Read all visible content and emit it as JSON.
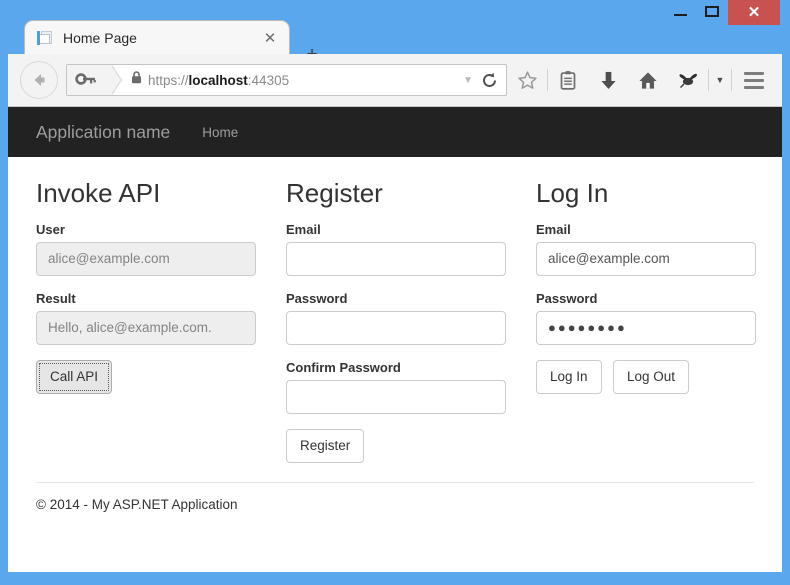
{
  "window": {
    "controls": {
      "minimize_label": "Minimize",
      "maximize_label": "Maximize",
      "close_label": "✕"
    },
    "frame_color": "#5aa7ee",
    "close_color": "#c7524f"
  },
  "browser": {
    "tab": {
      "title": "Home Page",
      "close_label": "✕",
      "favicon_name": "page-favicon"
    },
    "newtab_label": "+",
    "toolbar": {
      "back_label": "Back",
      "url_scheme": "https://",
      "url_host": "localhost",
      "url_port": ":44305",
      "url_full": "https://localhost:44305",
      "url_caret": "▼",
      "reload_label": "Reload",
      "buttons": [
        {
          "name": "bookmark-star-icon",
          "label": "Bookmark"
        },
        {
          "name": "reading-list-icon",
          "label": "Reading list"
        },
        {
          "name": "downloads-icon",
          "label": "Downloads"
        },
        {
          "name": "home-icon",
          "label": "Home"
        },
        {
          "name": "sync-icon",
          "label": "Sync"
        }
      ],
      "overflow_caret": "▼",
      "menu_label": "Open menu"
    }
  },
  "site": {
    "navbar": {
      "brand": "Application name",
      "links": [
        {
          "label": "Home"
        }
      ]
    },
    "columns": [
      {
        "id": "invoke-api",
        "heading": "Invoke API",
        "fields": [
          {
            "id": "user",
            "label": "User",
            "value": "alice@example.com",
            "placeholder": "",
            "type": "text",
            "disabled": true
          },
          {
            "id": "result",
            "label": "Result",
            "value": "Hello, alice@example.com.",
            "placeholder": "",
            "type": "text",
            "disabled": true
          }
        ],
        "buttons": [
          {
            "id": "call-api",
            "label": "Call API",
            "focused": true
          }
        ]
      },
      {
        "id": "register",
        "heading": "Register",
        "fields": [
          {
            "id": "register-email",
            "label": "Email",
            "value": "",
            "placeholder": "",
            "type": "text",
            "disabled": false
          },
          {
            "id": "register-password",
            "label": "Password",
            "value": "",
            "placeholder": "",
            "type": "password",
            "disabled": false
          },
          {
            "id": "register-confirm-password",
            "label": "Confirm Password",
            "value": "",
            "placeholder": "",
            "type": "password",
            "disabled": false
          }
        ],
        "buttons": [
          {
            "id": "register",
            "label": "Register",
            "focused": false
          }
        ]
      },
      {
        "id": "log-in",
        "heading": "Log In",
        "fields": [
          {
            "id": "login-email",
            "label": "Email",
            "value": "alice@example.com",
            "placeholder": "",
            "type": "text",
            "disabled": false
          },
          {
            "id": "login-password",
            "label": "Password",
            "value": "●●●●●●●●",
            "placeholder": "",
            "type": "password",
            "disabled": false
          }
        ],
        "buttons": [
          {
            "id": "log-in",
            "label": "Log In",
            "focused": false
          },
          {
            "id": "log-out",
            "label": "Log Out",
            "focused": false
          }
        ]
      }
    ],
    "footer": {
      "text": "© 2014 - My ASP.NET Application"
    }
  }
}
